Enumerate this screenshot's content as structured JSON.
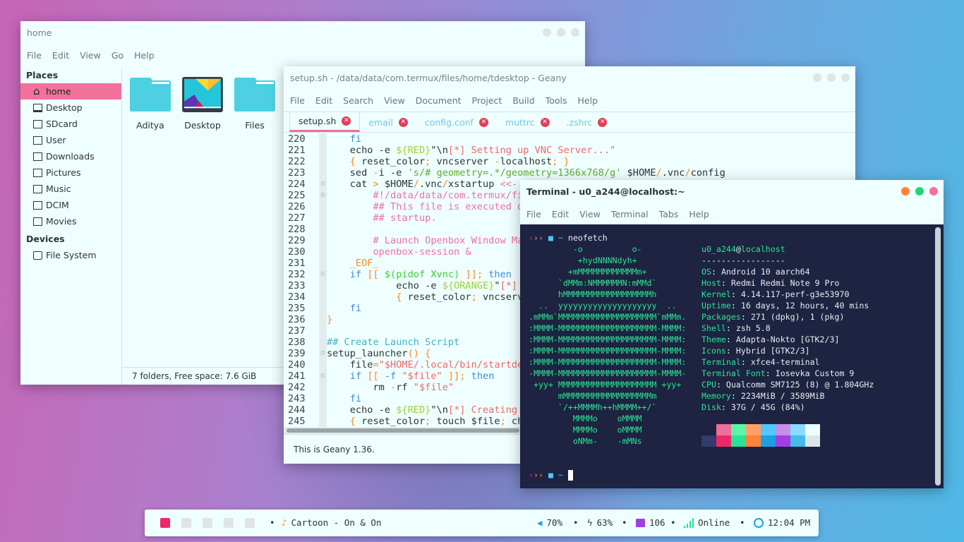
{
  "file_manager": {
    "title": "home",
    "menu": [
      "File",
      "Edit",
      "View",
      "Go",
      "Help"
    ],
    "places_label": "Places",
    "places": [
      "home",
      "Desktop",
      "SDcard",
      "User",
      "Downloads",
      "Pictures",
      "Music",
      "DCIM",
      "Movies"
    ],
    "devices_label": "Devices",
    "devices": [
      "File System"
    ],
    "files": [
      {
        "name": "Aditya",
        "icon": "folder"
      },
      {
        "name": "Desktop",
        "icon": "desktop-wallpaper"
      },
      {
        "name": "Files",
        "icon": "folder"
      }
    ],
    "status": "7 folders, Free space: 7.6 GiB"
  },
  "geany": {
    "title": "setup.sh - /data/data/com.termux/files/home/tdesktop - Geany",
    "menu": [
      "File",
      "Edit",
      "Search",
      "View",
      "Document",
      "Project",
      "Build",
      "Tools",
      "Help"
    ],
    "tabs": [
      "setup.sh",
      "email",
      "config.conf",
      "muttrc",
      ".zshrc"
    ],
    "active_tab": "setup.sh",
    "status": "This is Geany 1.36.",
    "colors": {
      "d": "#2d3436",
      "k": "#3b8ed4",
      "v": "#9ad23a",
      "s": "#ef6a6a",
      "o": "#ff8a1c",
      "c": "#f06eb0",
      "h": "#45b2c8",
      "g": "#5cab2c",
      "b": "#38d13a"
    },
    "fold_markers": [
      224,
      225,
      232,
      239,
      241
    ],
    "lines": [
      {
        "n": 220,
        "seg": [
          [
            "    ",
            "d"
          ],
          [
            "fi",
            "k"
          ]
        ]
      },
      {
        "n": 221,
        "seg": [
          [
            "    echo -e ",
            "d"
          ],
          [
            "${RED}",
            "v"
          ],
          [
            "\"\\n",
            "d"
          ],
          [
            "[*] Setting up VNC Server...\"",
            "s"
          ]
        ]
      },
      {
        "n": 222,
        "seg": [
          [
            "    ",
            "d"
          ],
          [
            "{",
            "o"
          ],
          [
            " reset_color",
            "d"
          ],
          [
            ";",
            "o"
          ],
          [
            " vncserver ",
            "d"
          ],
          [
            "-",
            "o"
          ],
          [
            "localhost",
            "d"
          ],
          [
            "; }",
            "o"
          ]
        ]
      },
      {
        "n": 223,
        "seg": [
          [
            "    sed ",
            "d"
          ],
          [
            "-",
            "o"
          ],
          [
            "i -e ",
            "d"
          ],
          [
            "'s/# geometry=.*/geometry=1366x768/g'",
            "g"
          ],
          [
            " $HOME",
            "d"
          ],
          [
            "/",
            "o"
          ],
          [
            ".vnc",
            "d"
          ],
          [
            "/",
            "o"
          ],
          [
            "config",
            "d"
          ]
        ]
      },
      {
        "n": 224,
        "seg": [
          [
            "    cat ",
            "d"
          ],
          [
            ">",
            "o"
          ],
          [
            " $HOME",
            "d"
          ],
          [
            "/",
            "o"
          ],
          [
            ".vnc",
            "d"
          ],
          [
            "/",
            "o"
          ],
          [
            "xstartup ",
            "d"
          ],
          [
            "<<-",
            "c"
          ]
        ]
      },
      {
        "n": 225,
        "seg": [
          [
            "        #!/data/data/com.termux/fi",
            "c"
          ]
        ]
      },
      {
        "n": 226,
        "seg": [
          [
            "        ## This file is executed d",
            "c"
          ]
        ]
      },
      {
        "n": 227,
        "seg": [
          [
            "        ## startup.",
            "c"
          ]
        ]
      },
      {
        "n": 228,
        "seg": []
      },
      {
        "n": 229,
        "seg": [
          [
            "        # Launch Openbox Window Ma",
            "c"
          ]
        ]
      },
      {
        "n": 230,
        "seg": [
          [
            "        openbox-session &",
            "c"
          ]
        ]
      },
      {
        "n": 231,
        "seg": [
          [
            "    _EOF_",
            "o"
          ]
        ]
      },
      {
        "n": 232,
        "seg": [
          [
            "    ",
            "d"
          ],
          [
            "if",
            "k"
          ],
          [
            " ",
            "d"
          ],
          [
            "[[",
            "o"
          ],
          [
            " ",
            "d"
          ],
          [
            "$(pidof Xvnc)",
            "b"
          ],
          [
            " ",
            "d"
          ],
          [
            "]];",
            "o"
          ],
          [
            " ",
            "d"
          ],
          [
            "then",
            "k"
          ]
        ]
      },
      {
        "n": 233,
        "seg": [
          [
            "            echo -e ",
            "d"
          ],
          [
            "${ORANGE}",
            "v"
          ],
          [
            "\"",
            "d"
          ],
          [
            "[*]",
            "s"
          ]
        ]
      },
      {
        "n": 234,
        "seg": [
          [
            "            ",
            "d"
          ],
          [
            "{",
            "o"
          ],
          [
            " reset_color",
            "d"
          ],
          [
            ";",
            "o"
          ],
          [
            " vncserv",
            "d"
          ]
        ]
      },
      {
        "n": 235,
        "seg": [
          [
            "    ",
            "d"
          ],
          [
            "fi",
            "k"
          ]
        ]
      },
      {
        "n": 236,
        "seg": [
          [
            "}",
            "o"
          ]
        ]
      },
      {
        "n": 237,
        "seg": []
      },
      {
        "n": 238,
        "seg": [
          [
            "## Create Launch Script",
            "h"
          ]
        ]
      },
      {
        "n": 239,
        "seg": [
          [
            "setup_launcher",
            "d"
          ],
          [
            "()",
            "o"
          ],
          [
            " ",
            "d"
          ],
          [
            "{",
            "o"
          ]
        ]
      },
      {
        "n": 240,
        "seg": [
          [
            "    file",
            "d"
          ],
          [
            "=",
            "o"
          ],
          [
            "\"$HOME/.local/bin/startde",
            "s"
          ]
        ]
      },
      {
        "n": 241,
        "seg": [
          [
            "    ",
            "d"
          ],
          [
            "if",
            "k"
          ],
          [
            " ",
            "d"
          ],
          [
            "[[",
            "o"
          ],
          [
            " ",
            "d"
          ],
          [
            "-f",
            "k"
          ],
          [
            " ",
            "d"
          ],
          [
            "\"$file\"",
            "s"
          ],
          [
            " ",
            "d"
          ],
          [
            "]];",
            "o"
          ],
          [
            " ",
            "d"
          ],
          [
            "then",
            "k"
          ]
        ]
      },
      {
        "n": 242,
        "seg": [
          [
            "        rm ",
            "d"
          ],
          [
            "-",
            "o"
          ],
          [
            "rf ",
            "d"
          ],
          [
            "\"$file\"",
            "s"
          ]
        ]
      },
      {
        "n": 243,
        "seg": [
          [
            "    ",
            "d"
          ],
          [
            "fi",
            "k"
          ]
        ]
      },
      {
        "n": 244,
        "seg": [
          [
            "    echo -e ",
            "d"
          ],
          [
            "${RED}",
            "v"
          ],
          [
            "\"\\n",
            "d"
          ],
          [
            "[*] Creating",
            "s"
          ]
        ]
      },
      {
        "n": 245,
        "seg": [
          [
            "    ",
            "d"
          ],
          [
            "{",
            "o"
          ],
          [
            " reset_color",
            "d"
          ],
          [
            ";",
            "o"
          ],
          [
            " touch $file",
            "d"
          ],
          [
            ";",
            "o"
          ],
          [
            " ch",
            "d"
          ]
        ]
      }
    ]
  },
  "terminal": {
    "title": "Terminal - u0_a244@localhost:~",
    "menu": [
      "File",
      "Edit",
      "View",
      "Terminal",
      "Tabs",
      "Help"
    ],
    "prompt_command": "neofetch",
    "prompt_dir": "~",
    "art_color": "#2ae396",
    "key_color": "#2ae396",
    "art": [
      "         -o          o-",
      "          +hydNNNNdyh+",
      "        +mMMMMMMMMMMMMm+",
      "      `dMMm:NMMMMMMN:mMMd`",
      "      hMMMMMMMMMMMMMMMMMMh",
      "  ..  yyyyyyyyyyyyyyyyyyyy  ..",
      ".mMMm`MMMMMMMMMMMMMMMMMMMM`mMMm.",
      ":MMMM-MMMMMMMMMMMMMMMMMMMM-MMMM:",
      ":MMMM-MMMMMMMMMMMMMMMMMMMM-MMMM:",
      ":MMMM-MMMMMMMMMMMMMMMMMMMM-MMMM:",
      ":MMMM-MMMMMMMMMMMMMMMMMMMM-MMMM:",
      "-MMMM-MMMMMMMMMMMMMMMMMMMM-MMMM-",
      " +yy+ MMMMMMMMMMMMMMMMMMMM +yy+",
      "      mMMMMMMMMMMMMMMMMMMm",
      "      `/++MMMMh++hMMMM++/`",
      "         MMMMo    oMMMM",
      "         MMMMo    oMMMM",
      "         oNMm-    -mMNs"
    ],
    "user": "u0_a244",
    "host": "localhost",
    "separator": "-----------------",
    "info": [
      [
        "OS",
        "Android 10 aarch64"
      ],
      [
        "Host",
        "Redmi Redmi Note 9 Pro"
      ],
      [
        "Kernel",
        "4.14.117-perf-g3e53970"
      ],
      [
        "Uptime",
        "16 days, 12 hours, 40 mins"
      ],
      [
        "Packages",
        "271 (dpkg), 1 (pkg)"
      ],
      [
        "Shell",
        "zsh 5.8"
      ],
      [
        "Theme",
        "Adapta-Nokto [GTK2/3]"
      ],
      [
        "Icons",
        "Hybrid [GTK2/3]"
      ],
      [
        "Terminal",
        "xfce4-terminal"
      ],
      [
        "Terminal Font",
        "Iosevka Custom 9"
      ],
      [
        "CPU",
        "Qualcomm SM7125 (8) @ 1.804GHz"
      ],
      [
        "Memory",
        "2234MiB / 3589MiB"
      ],
      [
        "Disk",
        "37G / 45G (84%)"
      ]
    ],
    "palette_top": [
      "#1d2340",
      "#f06e9a",
      "#5df5a7",
      "#ffa06a",
      "#52c6ff",
      "#c58fe8",
      "#8ad9ff",
      "#eaffff"
    ],
    "palette_bottom": [
      "#343c6b",
      "#ee2866",
      "#2ae396",
      "#ff8438",
      "#1ca0e2",
      "#a23de6",
      "#44bbe8",
      "#dce6e8"
    ],
    "window_buttons": [
      "#ff8438",
      "#1fd583",
      "#f2719a"
    ]
  },
  "taskbar": {
    "workspaces": 5,
    "active_workspace": 1,
    "accent": "#ee2866",
    "music": "Cartoon - On & On",
    "volume": "70%",
    "battery": "63%",
    "mail": "106",
    "network": "Online",
    "clock": "12:04 PM"
  }
}
